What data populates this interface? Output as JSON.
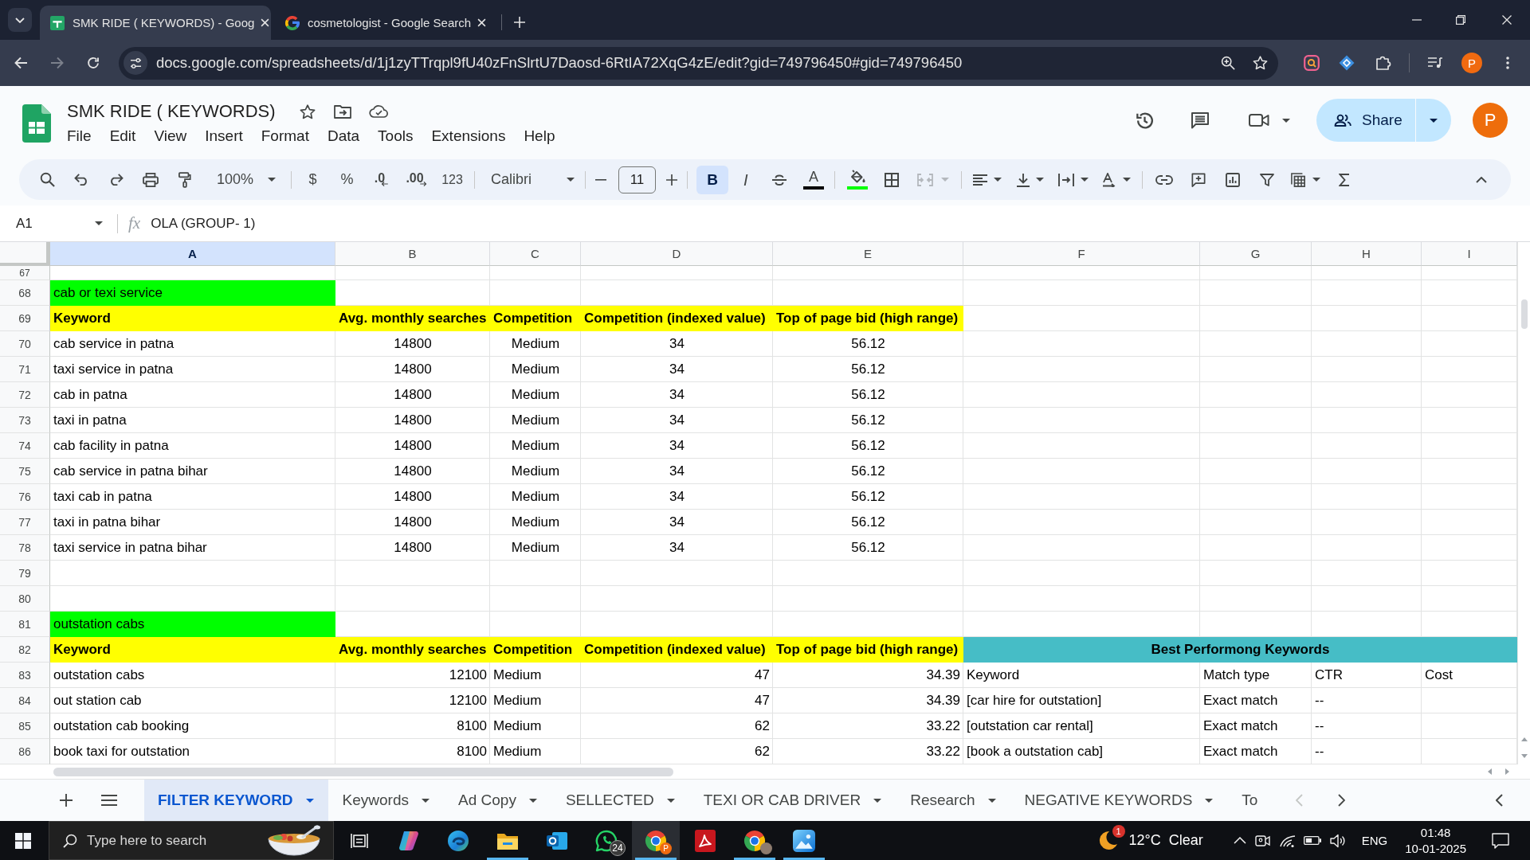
{
  "browser": {
    "tabs": [
      {
        "title": "SMK RIDE ( KEYWORDS) - Goog",
        "kind": "sheets",
        "selected": true
      },
      {
        "title": "cosmetologist - Google Search",
        "kind": "search",
        "selected": false
      }
    ],
    "forward_disabled": true,
    "url": "docs.google.com/spreadsheets/d/1j1zyTTrqpl9fU40zFnSlrtU7Daosd-6RtIA72XqG4zE/edit?gid=749796450#gid=749796450",
    "profile": "P"
  },
  "doc": {
    "title": "SMK RIDE ( KEYWORDS)",
    "menu": [
      "File",
      "Edit",
      "View",
      "Insert",
      "Format",
      "Data",
      "Tools",
      "Extensions",
      "Help"
    ],
    "share": "Share",
    "avatar": "P"
  },
  "toolbar": {
    "zoom": "100%",
    "currency": "$",
    "percent": "%",
    "decrease_decimal": ".0",
    "increase_decimal": ".00",
    "number_format": "123",
    "font": "Calibri",
    "font_size": "11",
    "text_style": [
      {
        "kind": "bold",
        "label": "B",
        "on": true
      },
      {
        "kind": "italic",
        "label": "I",
        "on": false
      },
      {
        "kind": "strikethrough",
        "on": false
      }
    ],
    "text_color_label": "A",
    "merge_disabled": true
  },
  "formula_bar": {
    "name_box": "A1",
    "fx": "fx",
    "formula": "OLA (GROUP- 1)"
  },
  "grid": {
    "columns": [
      {
        "label": "A",
        "selected": true
      },
      {
        "label": "B",
        "selected": false
      },
      {
        "label": "C",
        "selected": false
      },
      {
        "label": "D",
        "selected": false
      },
      {
        "label": "E",
        "selected": false
      },
      {
        "label": "F",
        "selected": false
      },
      {
        "label": "G",
        "selected": false
      },
      {
        "label": "H",
        "selected": false
      },
      {
        "label": "I",
        "selected": false
      }
    ],
    "rows": [
      {
        "number": "67",
        "kind": "empty"
      },
      {
        "number": "68",
        "kind": "title",
        "cells": [
          {
            "text": "cab or texi service",
            "color": "#00ff00"
          }
        ]
      },
      {
        "number": "69",
        "kind": "header",
        "cells": [
          {
            "text": "Keyword",
            "color": "#ffff00"
          },
          {
            "text": "Avg. monthly searches",
            "color": "#ffff00"
          },
          {
            "text": "Competition",
            "color": "#ffff00"
          },
          {
            "text": "Competition (indexed value)",
            "color": "#ffff00"
          },
          {
            "text": "Top of page bid (high range)",
            "color": "#ffff00"
          }
        ]
      },
      {
        "number": "70",
        "kind": "centered",
        "cells": [
          {
            "text": "cab service in patna"
          },
          {
            "text": "14800"
          },
          {
            "text": "Medium"
          },
          {
            "text": "34"
          },
          {
            "text": "56.12"
          }
        ]
      },
      {
        "number": "71",
        "kind": "centered",
        "cells": [
          {
            "text": "taxi service in patna"
          },
          {
            "text": "14800"
          },
          {
            "text": "Medium"
          },
          {
            "text": "34"
          },
          {
            "text": "56.12"
          }
        ]
      },
      {
        "number": "72",
        "kind": "centered",
        "cells": [
          {
            "text": "cab in patna"
          },
          {
            "text": "14800"
          },
          {
            "text": "Medium"
          },
          {
            "text": "34"
          },
          {
            "text": "56.12"
          }
        ]
      },
      {
        "number": "73",
        "kind": "centered",
        "cells": [
          {
            "text": "taxi in patna"
          },
          {
            "text": "14800"
          },
          {
            "text": "Medium"
          },
          {
            "text": "34"
          },
          {
            "text": "56.12"
          }
        ]
      },
      {
        "number": "74",
        "kind": "centered",
        "cells": [
          {
            "text": "cab facility in patna"
          },
          {
            "text": "14800"
          },
          {
            "text": "Medium"
          },
          {
            "text": "34"
          },
          {
            "text": "56.12"
          }
        ]
      },
      {
        "number": "75",
        "kind": "centered",
        "cells": [
          {
            "text": "cab service in patna bihar"
          },
          {
            "text": "14800"
          },
          {
            "text": "Medium"
          },
          {
            "text": "34"
          },
          {
            "text": "56.12"
          }
        ]
      },
      {
        "number": "76",
        "kind": "centered",
        "cells": [
          {
            "text": "taxi cab in patna"
          },
          {
            "text": "14800"
          },
          {
            "text": "Medium"
          },
          {
            "text": "34"
          },
          {
            "text": "56.12"
          }
        ]
      },
      {
        "number": "77",
        "kind": "centered",
        "cells": [
          {
            "text": "taxi in patna bihar"
          },
          {
            "text": "14800"
          },
          {
            "text": "Medium"
          },
          {
            "text": "34"
          },
          {
            "text": "56.12"
          }
        ]
      },
      {
        "number": "78",
        "kind": "centered",
        "cells": [
          {
            "text": "taxi service in patna bihar"
          },
          {
            "text": "14800"
          },
          {
            "text": "Medium"
          },
          {
            "text": "34"
          },
          {
            "text": "56.12"
          }
        ]
      },
      {
        "number": "79",
        "kind": "empty"
      },
      {
        "number": "80",
        "kind": "empty"
      },
      {
        "number": "81",
        "kind": "title",
        "cells": [
          {
            "text": "outstation cabs",
            "color": "#00ff00"
          }
        ]
      },
      {
        "number": "82",
        "kind": "header",
        "cells": [
          {
            "text": "Keyword",
            "color": "#ffff00"
          },
          {
            "text": "Avg. monthly searches",
            "color": "#ffff00"
          },
          {
            "text": "Competition",
            "color": "#ffff00"
          },
          {
            "text": "Competition (indexed value)",
            "color": "#ffff00"
          },
          {
            "text": "Top of page bid (high range)",
            "color": "#ffff00"
          }
        ],
        "banner": {
          "text": "Best Performong Keywords",
          "color": "#46bdc6"
        }
      },
      {
        "number": "83",
        "kind": "plain",
        "cells": [
          {
            "text": "outstation cabs"
          },
          {
            "text": "12100"
          },
          {
            "text": "Medium"
          },
          {
            "text": "47"
          },
          {
            "text": "34.39"
          },
          {
            "text": "Keyword"
          },
          {
            "text": "Match type"
          },
          {
            "text": "CTR"
          },
          {
            "text": "Cost"
          }
        ]
      },
      {
        "number": "84",
        "kind": "plain",
        "cells": [
          {
            "text": "out station cab"
          },
          {
            "text": "12100"
          },
          {
            "text": "Medium"
          },
          {
            "text": "47"
          },
          {
            "text": "34.39"
          },
          {
            "text": "[car hire for outstation]"
          },
          {
            "text": "Exact match"
          },
          {
            "text": "--"
          }
        ]
      },
      {
        "number": "85",
        "kind": "plain",
        "cells": [
          {
            "text": "outstation cab booking"
          },
          {
            "text": "8100"
          },
          {
            "text": "Medium"
          },
          {
            "text": "62"
          },
          {
            "text": "33.22"
          },
          {
            "text": "[outstation car rental]"
          },
          {
            "text": "Exact match"
          },
          {
            "text": "--"
          }
        ]
      },
      {
        "number": "86",
        "kind": "plain",
        "cells": [
          {
            "text": "book taxi for outstation"
          },
          {
            "text": "8100"
          },
          {
            "text": "Medium"
          },
          {
            "text": "62"
          },
          {
            "text": "33.22"
          },
          {
            "text": "[book a outstation cab]"
          },
          {
            "text": "Exact match"
          },
          {
            "text": "--"
          }
        ]
      }
    ]
  },
  "sheets": {
    "tabs": [
      {
        "label": "FILTER KEYWORD",
        "selected": true,
        "cut": false
      },
      {
        "label": "Keywords",
        "selected": false,
        "cut": false
      },
      {
        "label": "Ad Copy",
        "selected": false,
        "cut": false
      },
      {
        "label": "SELLECTED",
        "selected": false,
        "cut": false
      },
      {
        "label": "TEXI OR CAB DRIVER",
        "selected": false,
        "cut": false
      },
      {
        "label": "Research",
        "selected": false,
        "cut": false
      },
      {
        "label": "NEGATIVE KEYWORDS",
        "selected": false,
        "cut": false
      },
      {
        "label": "To",
        "selected": false,
        "cut": true
      }
    ],
    "prev_disabled": true
  },
  "taskbar": {
    "search_placeholder": "Type here to search",
    "apps": [
      {
        "kind": "task-view",
        "running": false,
        "active": false
      },
      {
        "kind": "swirl",
        "running": false,
        "active": false
      },
      {
        "kind": "wave",
        "running": false,
        "active": false
      },
      {
        "kind": "folder",
        "running": true,
        "active": false
      },
      {
        "kind": "mail",
        "running": false,
        "active": false
      },
      {
        "kind": "chat",
        "badge": "24",
        "running": false,
        "active": false
      },
      {
        "kind": "browser",
        "badge": "P",
        "running": true,
        "active": true
      },
      {
        "kind": "pdf",
        "running": false,
        "active": false
      },
      {
        "kind": "browser-avatar",
        "running": true,
        "active": false
      },
      {
        "kind": "photos",
        "running": true,
        "active": false
      }
    ],
    "weather": {
      "temperature": "12°C",
      "condition": "Clear",
      "badge": "1"
    },
    "language": "ENG",
    "time": "01:48",
    "date": "10-01-2025"
  }
}
